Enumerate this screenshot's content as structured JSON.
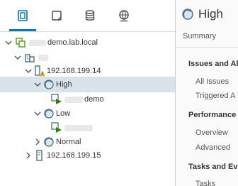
{
  "navigator": {
    "tabs": [
      {
        "icon": "hosts-and-clusters-icon",
        "active": true
      },
      {
        "icon": "vms-and-templates-icon",
        "active": false
      },
      {
        "icon": "storage-icon",
        "active": false
      },
      {
        "icon": "networking-icon",
        "active": false
      }
    ],
    "tree": [
      {
        "label": "demo.lab.local",
        "icon": "vcenter-icon",
        "expanded": true
      },
      {
        "label": "",
        "icon": "datacenter-icon",
        "expanded": true
      },
      {
        "label": "192.168.199.14",
        "icon": "host-warning-icon",
        "expanded": true
      },
      {
        "label": "High",
        "icon": "resource-pool-icon",
        "expanded": true,
        "selected": true
      },
      {
        "label": "demo",
        "icon": "vm-powered-on-icon"
      },
      {
        "label": "Low",
        "icon": "resource-pool-icon",
        "expanded": true
      },
      {
        "label": "",
        "icon": "vm-powered-on-icon"
      },
      {
        "label": "Normal",
        "icon": "resource-pool-icon",
        "expanded": false
      },
      {
        "label": "192.168.199.15",
        "icon": "host-icon",
        "expanded": false
      }
    ]
  },
  "main": {
    "title": "High",
    "tab": "Summary",
    "sections": [
      {
        "title": "Issues and Ala",
        "links": [
          "All Issues",
          "Triggered A"
        ]
      },
      {
        "title": "Performance",
        "links": [
          "Overview",
          "Advanced"
        ]
      },
      {
        "title": "Tasks and Eve",
        "links": [
          "Tasks"
        ]
      }
    ]
  },
  "colors": {
    "accent": "#0079b8",
    "selection": "#d8e3e9",
    "warning": "#efc006",
    "vm_running": "#2f8400"
  }
}
